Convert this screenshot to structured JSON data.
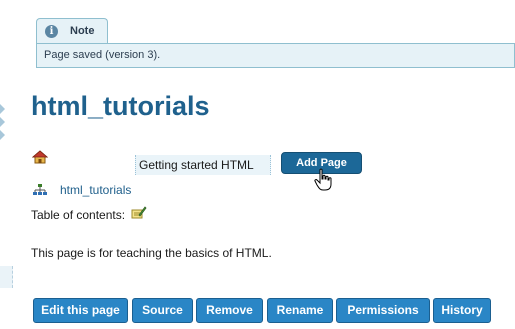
{
  "note": {
    "title": "Note",
    "message": "Page saved (version 3)."
  },
  "page": {
    "title": "html_tutorials",
    "content": "This page is for teaching the basics of HTML."
  },
  "add_page": {
    "field_value": "Getting started HTML",
    "button_label": "Add Page"
  },
  "structure": {
    "link_label": "html_tutorials"
  },
  "toc": {
    "label": "Table of contents:"
  },
  "actions": [
    {
      "label": "Edit this page"
    },
    {
      "label": "Source"
    },
    {
      "label": "Remove"
    },
    {
      "label": "Rename"
    },
    {
      "label": "Permissions"
    },
    {
      "label": "History"
    }
  ],
  "icons": {
    "note": "info-icon",
    "home": "home-icon",
    "structure": "structure-icon",
    "toc": "toc-edit-icon",
    "cursor": "hand-cursor-icon"
  },
  "colors": {
    "note_bg": "#e6f2f7",
    "note_border": "#8fbfcf",
    "title": "#1f618d",
    "button": "#2a86c6",
    "add_button": "#1c6898",
    "link": "#1f5f8b"
  }
}
